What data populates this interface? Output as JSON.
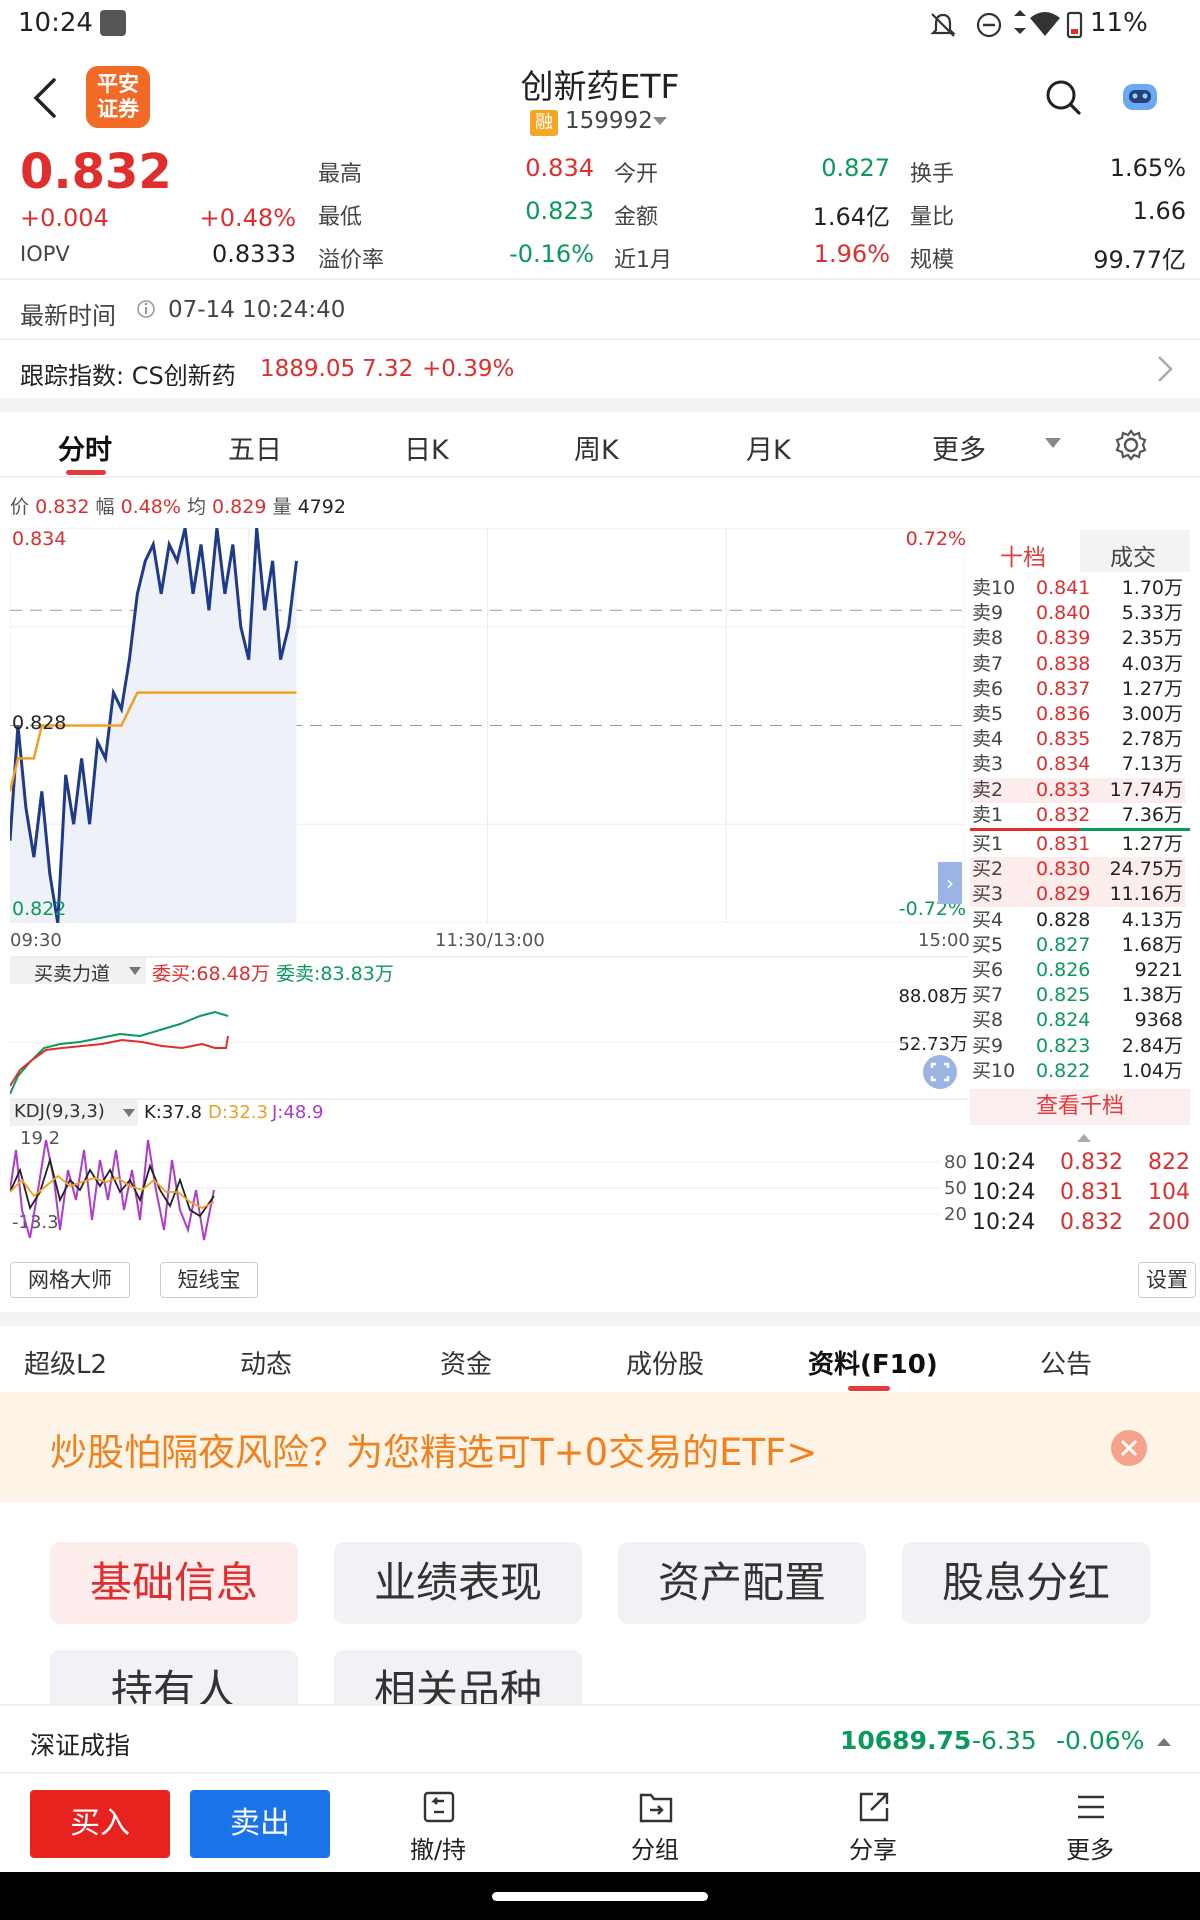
{
  "status_bar": {
    "time": "10:24",
    "battery": "11%"
  },
  "header": {
    "title": "创新药ETF",
    "badge": "融",
    "code": "159992",
    "logo_lines": [
      "平安",
      "证券"
    ]
  },
  "quote": {
    "price": "0.832",
    "change": "+0.004",
    "change_pct": "+0.48%",
    "iopv_label": "IOPV",
    "iopv": "0.8333",
    "fields": [
      {
        "label": "最高",
        "value": "0.834",
        "color": "red"
      },
      {
        "label": "今开",
        "value": "0.827",
        "color": "green"
      },
      {
        "label": "换手",
        "value": "1.65%",
        "color": "dark"
      },
      {
        "label": "最低",
        "value": "0.823",
        "color": "green"
      },
      {
        "label": "金额",
        "value": "1.64亿",
        "color": "dark"
      },
      {
        "label": "量比",
        "value": "1.66",
        "color": "dark"
      },
      {
        "label": "溢价率",
        "value": "-0.16%",
        "color": "green"
      },
      {
        "label": "近1月",
        "value": "1.96%",
        "color": "red"
      },
      {
        "label": "规模",
        "value": "99.77亿",
        "color": "dark"
      }
    ]
  },
  "latest_time": {
    "label": "最新时间",
    "value": "07-14 10:24:40"
  },
  "index_tracking": {
    "label": "跟踪指数: CS创新药",
    "value": "1889.05",
    "change": "7.32",
    "pct": "+0.39%"
  },
  "chart_tabs": [
    "分时",
    "五日",
    "日K",
    "周K",
    "月K",
    "更多"
  ],
  "chart_info": {
    "price_label": "价",
    "price": "0.832",
    "amp_label": "幅",
    "amp": "0.48%",
    "avg_label": "均",
    "avg": "0.829",
    "vol_label": "量",
    "vol": "4792"
  },
  "chart_axis": {
    "top_left": "0.834",
    "mid_left": "0.828",
    "bottom_left": "0.822",
    "top_right": "0.72%",
    "bottom_right": "-0.72%",
    "t_start": "09:30",
    "t_mid": "11:30/13:00",
    "t_end": "15:00"
  },
  "chart_data": {
    "type": "line",
    "x": [
      0,
      2,
      4,
      6,
      8,
      10,
      12,
      14,
      16,
      18,
      20,
      22,
      24,
      26,
      28,
      30,
      32,
      34,
      36,
      38,
      40,
      42,
      44,
      46,
      48,
      50,
      52,
      54,
      56,
      58,
      60,
      62,
      64,
      66,
      68,
      70,
      72
    ],
    "series": [
      {
        "values": [
          0.8245,
          0.828,
          0.8255,
          0.824,
          0.826,
          0.8235,
          0.822,
          0.8265,
          0.825,
          0.827,
          0.825,
          0.8275,
          0.827,
          0.829,
          0.8285,
          0.83,
          0.832,
          0.833,
          0.8335,
          0.832,
          0.8335,
          0.833,
          0.834,
          0.832,
          0.8335,
          0.8315,
          0.834,
          0.832,
          0.8335,
          0.831,
          0.83,
          0.834,
          0.8315,
          0.833,
          0.83,
          0.831,
          0.833
        ]
      },
      {
        "values": [
          0.826,
          0.827,
          0.827,
          0.827,
          0.828,
          0.828,
          0.828,
          0.828,
          0.828,
          0.828,
          0.828,
          0.828,
          0.828,
          0.828,
          0.828,
          0.8285,
          0.829,
          0.829,
          0.829,
          0.829,
          0.829,
          0.829,
          0.829,
          0.829,
          0.829,
          0.829,
          0.829,
          0.829,
          0.829,
          0.829,
          0.829,
          0.829,
          0.829,
          0.829,
          0.829,
          0.829,
          0.829
        ]
      }
    ],
    "ylim": [
      0.822,
      0.834
    ],
    "xlim": [
      0,
      240
    ]
  },
  "orderbook_tabs": [
    "十档",
    "成交"
  ],
  "sells": [
    {
      "label": "卖10",
      "price": "0.841",
      "vol": "1.70万"
    },
    {
      "label": "卖9",
      "price": "0.840",
      "vol": "5.33万"
    },
    {
      "label": "卖8",
      "price": "0.839",
      "vol": "2.35万"
    },
    {
      "label": "卖7",
      "price": "0.838",
      "vol": "4.03万"
    },
    {
      "label": "卖6",
      "price": "0.837",
      "vol": "1.27万"
    },
    {
      "label": "卖5",
      "price": "0.836",
      "vol": "3.00万"
    },
    {
      "label": "卖4",
      "price": "0.835",
      "vol": "2.78万"
    },
    {
      "label": "卖3",
      "price": "0.834",
      "vol": "7.13万"
    },
    {
      "label": "卖2",
      "price": "0.833",
      "vol": "17.74万"
    },
    {
      "label": "卖1",
      "price": "0.832",
      "vol": "7.36万"
    }
  ],
  "buys": [
    {
      "label": "买1",
      "price": "0.831",
      "vol": "1.27万"
    },
    {
      "label": "买2",
      "price": "0.830",
      "vol": "24.75万"
    },
    {
      "label": "买3",
      "price": "0.829",
      "vol": "11.16万"
    },
    {
      "label": "买4",
      "price": "0.828",
      "vol": "4.13万"
    },
    {
      "label": "买5",
      "price": "0.827",
      "vol": "1.68万"
    },
    {
      "label": "买6",
      "price": "0.826",
      "vol": "9221"
    },
    {
      "label": "买7",
      "price": "0.825",
      "vol": "1.38万"
    },
    {
      "label": "买8",
      "price": "0.824",
      "vol": "9368"
    },
    {
      "label": "买9",
      "price": "0.823",
      "vol": "2.84万"
    },
    {
      "label": "买10",
      "price": "0.822",
      "vol": "1.04万"
    }
  ],
  "view_more_depth": "查看千档",
  "ticks": [
    {
      "time": "10:24",
      "price": "0.832",
      "vol": "822"
    },
    {
      "time": "10:24",
      "price": "0.831",
      "vol": "104"
    },
    {
      "time": "10:24",
      "price": "0.832",
      "vol": "200"
    }
  ],
  "force": {
    "label": "买卖力道",
    "buy": "委买:68.48万",
    "sell": "委卖:83.83万",
    "top": "88.08万",
    "bottom": "52.73万"
  },
  "kdj": {
    "label": "KDJ(9,3,3)",
    "k": "K:37.8",
    "d": "D:32.3",
    "j": "J:48.9",
    "top": "19.2",
    "bottom": "-13.3",
    "r80": "80",
    "r50": "50",
    "r20": "20"
  },
  "tools": {
    "grid": "网格大师",
    "short": "短线宝",
    "settings": "设置"
  },
  "section_tabs": [
    "超级L2",
    "动态",
    "资金",
    "成份股",
    "资料(F10)",
    "公告"
  ],
  "banner": "炒股怕隔夜风险？为您精选可T+0交易的ETF>",
  "f10_buttons": [
    "基础信息",
    "业绩表现",
    "资产配置",
    "股息分红",
    "持有人",
    "相关品种"
  ],
  "index_bar": {
    "name": "深证成指",
    "value": "10689.75",
    "change": "-6.35",
    "pct": "-0.06%"
  },
  "bottom_bar": {
    "buy": "买入",
    "sell": "卖出",
    "cancel": "撤/持",
    "group": "分组",
    "share": "分享",
    "more": "更多"
  },
  "colors": {
    "red": "#e02e2e",
    "green": "#0a9a5a",
    "blue_line": "#1f3a8a",
    "avg_line": "#f0a020",
    "accent": "#e23c3c",
    "sell_btn": "#1a73e8"
  }
}
